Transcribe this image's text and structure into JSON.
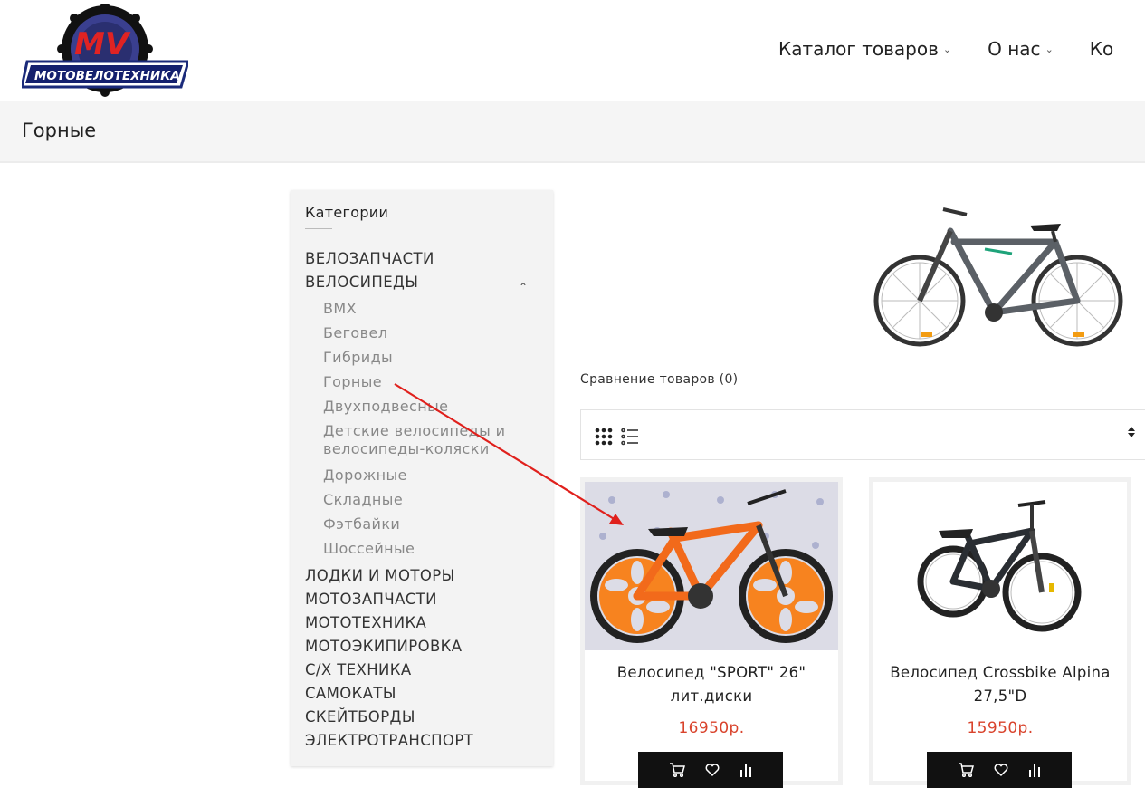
{
  "logo": {
    "letters": "MV",
    "text": "МОТОВЕЛОТЕХНИКА"
  },
  "nav": [
    {
      "label": "Каталог товаров",
      "chevron": "⌄"
    },
    {
      "label": "О нас",
      "chevron": "⌄"
    },
    {
      "label": "Ко"
    }
  ],
  "page_title": "Горные",
  "sidebar": {
    "title": "Категории",
    "top_categories": [
      "ВЕЛОЗАПЧАСТИ",
      "ВЕЛОСИПЕДЫ"
    ],
    "sub_categories": [
      "BMX",
      "Беговел",
      "Гибриды",
      "Горные",
      "Двухподвесные",
      "Детские велосипеды и велосипеды-коляски",
      "Дорожные",
      "Складные",
      "Фэтбайки",
      "Шоссейные"
    ],
    "other_categories": [
      "ЛОДКИ И МОТОРЫ",
      "МОТОЗАПЧАСТИ",
      "МОТОТЕХНИКА",
      "МОТОЭКИПИРОВКА",
      "С/Х ТЕХНИКА",
      "САМОКАТЫ",
      "СКЕЙТБОРДЫ",
      "ЭЛЕКТРОТРАНСПОРТ"
    ]
  },
  "compare": "Сравнение товаров (0)",
  "products": [
    {
      "name": "Велосипед \"SPORT\" 26\" лит.диски",
      "price": "16950р.",
      "frame_color": "#f26a1b"
    },
    {
      "name": "Велосипед Crossbike Alpina 27,5\"D",
      "price": "15950р.",
      "frame_color": "#2a2e33"
    }
  ],
  "colors": {
    "price": "#d9432c",
    "annotation_arrow": "#e0201c",
    "sidebar_bg": "#f3f3f3"
  },
  "icons": [
    "cart-icon",
    "heart-icon",
    "compare-icon",
    "grid-view-icon",
    "list-view-icon",
    "sort-icon"
  ]
}
